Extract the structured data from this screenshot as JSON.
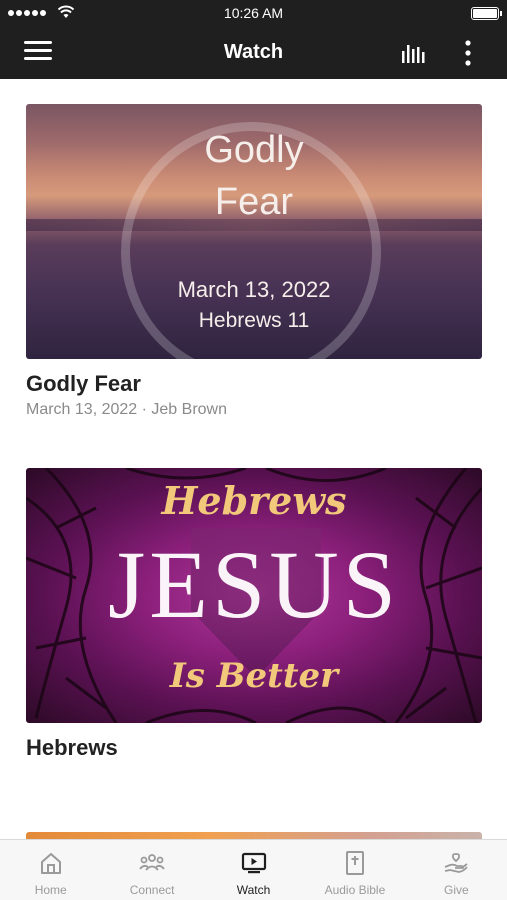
{
  "status_bar": {
    "time": "10:26 AM"
  },
  "header": {
    "title": "Watch",
    "menu_icon": "hamburger-menu-icon",
    "audio_icon": "audio-levels-icon",
    "more_icon": "vertical-ellipsis-icon"
  },
  "media": [
    {
      "thumbnail": {
        "line1": "Godly",
        "line2": "Fear",
        "date": "March 13, 2022",
        "reference": "Hebrews 11"
      },
      "title": "Godly Fear",
      "meta": "March 13, 2022 · Jeb Brown"
    },
    {
      "thumbnail": {
        "top": "Hebrews",
        "main": "JESUS",
        "bottom": "Is Better"
      },
      "title": "Hebrews"
    }
  ],
  "tabs": [
    {
      "label": "Home",
      "icon": "home-icon",
      "active": false
    },
    {
      "label": "Connect",
      "icon": "people-icon",
      "active": false
    },
    {
      "label": "Watch",
      "icon": "video-icon",
      "active": true
    },
    {
      "label": "Audio Bible",
      "icon": "bible-icon",
      "active": false
    },
    {
      "label": "Give",
      "icon": "give-hand-icon",
      "active": false
    }
  ],
  "colors": {
    "bar_background": "#1f1f1f",
    "active_tab": "#1f1f1f",
    "inactive_tab": "#9a9a9a"
  }
}
